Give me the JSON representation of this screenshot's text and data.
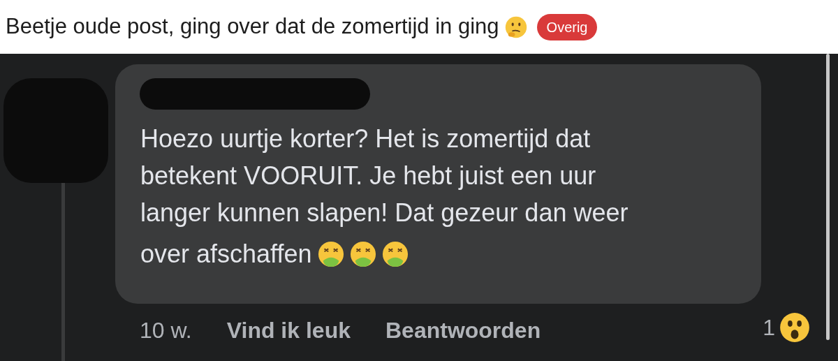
{
  "post": {
    "title": "Beetje oude post, ging over dat de zomertijd in ging",
    "flair": "Overig"
  },
  "comment": {
    "text_lines": [
      "Hoezo uurtje korter? Het is zomertijd dat",
      "betekent VOORUIT. Je hebt juist een uur",
      "langer kunnen slapen! Dat gezeur dan weer"
    ],
    "last_line": "over afschaffen",
    "age": "10 w.",
    "actions": [
      "Vind ik leuk",
      "Beantwoorden"
    ],
    "reaction_count": "1"
  }
}
